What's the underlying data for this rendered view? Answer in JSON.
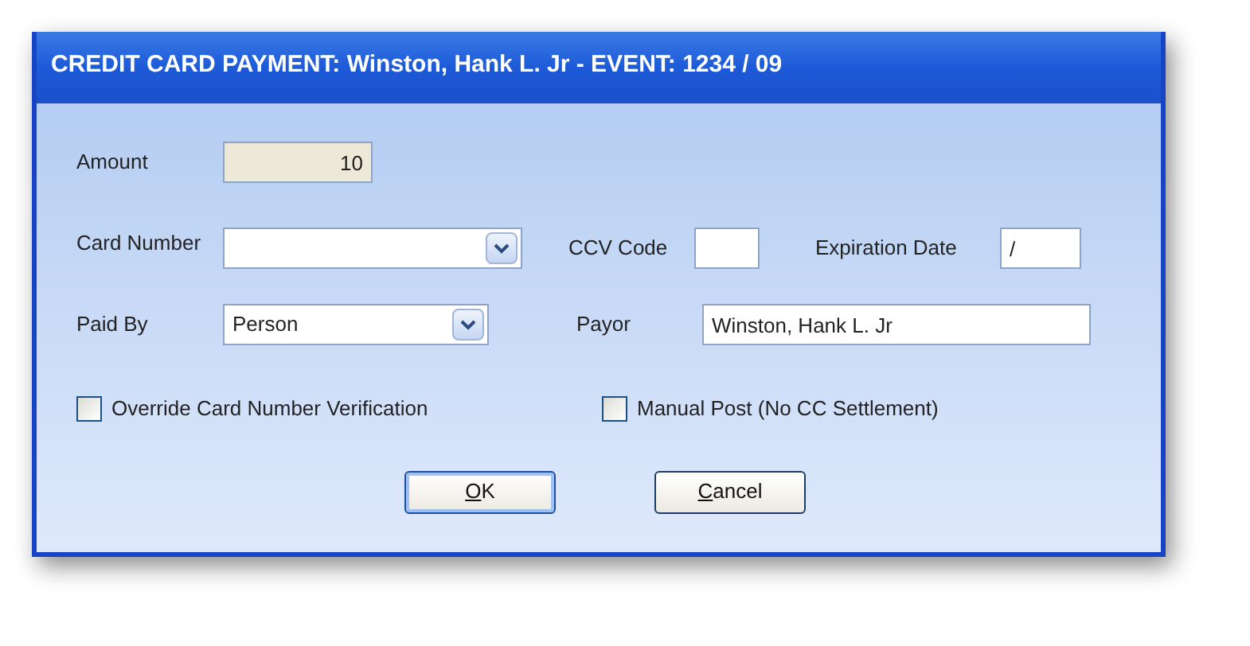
{
  "window": {
    "title": "CREDIT CARD PAYMENT: Winston, Hank L. Jr - EVENT: 1234 / 09"
  },
  "amount": {
    "label": "Amount",
    "value": "10"
  },
  "card_number": {
    "label": "Card Number"
  },
  "ccv_code": {
    "label": "CCV Code"
  },
  "expiration_date": {
    "label": "Expiration Date",
    "value": "/"
  },
  "paid_by": {
    "label": "Paid By",
    "value": "Person"
  },
  "payor": {
    "label": "Payor",
    "value": "Winston, Hank L. Jr"
  },
  "checkboxes": [
    {
      "label": "Override Card Number Verification",
      "checked": false
    },
    {
      "label": "Manual Post (No CC Settlement)",
      "checked": false
    }
  ],
  "buttons": [
    {
      "label": "OK",
      "default": true
    },
    {
      "label": "Cancel",
      "default": false
    }
  ]
}
